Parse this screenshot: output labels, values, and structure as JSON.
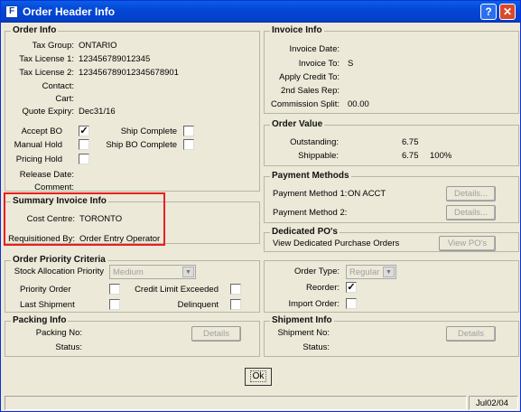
{
  "window": {
    "title": "Order Header Info",
    "help_label": "?",
    "close_label": "✕"
  },
  "order_info": {
    "title": "Order Info",
    "fields": [
      {
        "label": "Tax Group:",
        "value": "ONTARIO"
      },
      {
        "label": "Tax License 1:",
        "value": "123456789012345"
      },
      {
        "label": "Tax License 2:",
        "value": "12345678901234567890​1"
      },
      {
        "label": "Contact:",
        "value": ""
      },
      {
        "label": "Cart:",
        "value": ""
      },
      {
        "label": "Quote Expiry:",
        "value": "Dec31/16"
      }
    ],
    "accept_bo": {
      "label": "Accept BO",
      "checked": true
    },
    "manual_hold": {
      "label": "Manual Hold",
      "checked": false
    },
    "pricing_hold": {
      "label": "Pricing Hold",
      "checked": false
    },
    "ship_complete": {
      "label": "Ship Complete",
      "checked": false
    },
    "ship_bo_complete": {
      "label": "Ship BO Complete",
      "checked": false
    },
    "release_date_label": "Release Date:",
    "comment_label": "Comment:"
  },
  "summary_invoice": {
    "title": "Summary Invoice Info",
    "cost_centre_label": "Cost Centre:",
    "cost_centre_value": "TORONTO",
    "requisitioned_label": "Requisitioned By:",
    "requisitioned_value": "Order Entry Operator"
  },
  "invoice_info": {
    "title": "Invoice Info",
    "fields": [
      {
        "label": "Invoice Date:",
        "value": ""
      },
      {
        "label": "Invoice To:",
        "value": "S"
      },
      {
        "label": "Apply Credit To:",
        "value": ""
      },
      {
        "label": "2nd Sales Rep:",
        "value": ""
      },
      {
        "label": "Commission Split:",
        "value": "00.00"
      }
    ]
  },
  "order_value": {
    "title": "Order Value",
    "outstanding_label": "Outstanding:",
    "outstanding_value": "6.75",
    "shippable_label": "Shippable:",
    "shippable_value": "6.75",
    "shippable_pct": "100%"
  },
  "payment_methods": {
    "title": "Payment Methods",
    "method1_label": "Payment Method 1:",
    "method1_value": "ON ACCT",
    "method2_label": "Payment Method 2:",
    "details_label": "Details..."
  },
  "dedicated_po": {
    "title": "Dedicated PO's",
    "text": "View Dedicated Purchase Orders",
    "button": "View PO's"
  },
  "priority": {
    "title": "Order Priority Criteria",
    "stock_alloc_label": "Stock Allocation Priority",
    "stock_alloc_value": "Medium",
    "priority_order_label": "Priority Order",
    "credit_limit_label": "Credit Limit Exceeded",
    "last_shipment_label": "Last Shipment",
    "delinquent_label": "Delinquent"
  },
  "order_type": {
    "label": "Order Type:",
    "value": "Regular",
    "reorder_label": "Reorder:",
    "reorder_checked": true,
    "import_label": "Import Order:"
  },
  "packing": {
    "title": "Packing Info",
    "packing_no_label": "Packing No:",
    "status_label": "Status:",
    "details_label": "Details"
  },
  "shipment": {
    "title": "Shipment Info",
    "shipment_no_label": "Shipment No:",
    "status_label": "Status:",
    "details_label": "Details"
  },
  "ok_label": "Ok",
  "status_date": "Jul02/04",
  "check_mark": "✓"
}
